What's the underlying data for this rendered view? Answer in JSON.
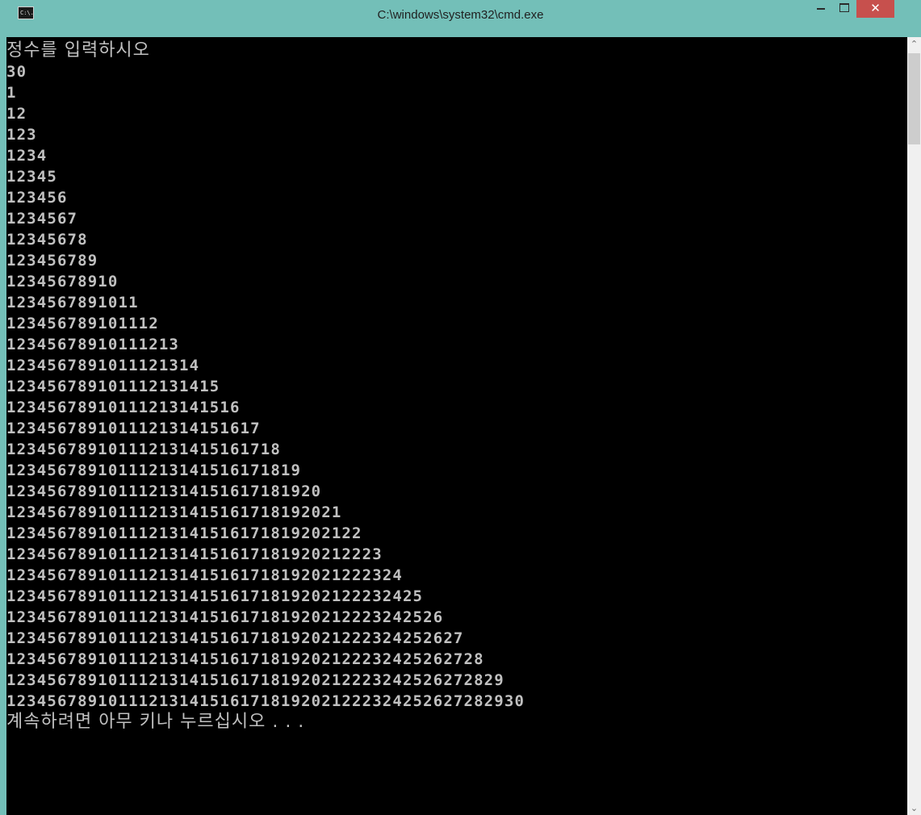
{
  "window": {
    "title": "C:\\windows\\system32\\cmd.exe",
    "icon_label": "C:\\.",
    "close_glyph": "✕"
  },
  "console": {
    "lines": [
      "정수를 입력하시오",
      "30",
      "1",
      "12",
      "123",
      "1234",
      "12345",
      "123456",
      "1234567",
      "12345678",
      "123456789",
      "12345678910",
      "1234567891011",
      "123456789101112",
      "12345678910111213",
      "1234567891011121314",
      "123456789101112131415",
      "12345678910111213141516",
      "1234567891011121314151617",
      "123456789101112131415161718",
      "12345678910111213141516171819",
      "1234567891011121314151617181920",
      "123456789101112131415161718192021",
      "12345678910111213141516171819202122",
      "1234567891011121314151617181920212223",
      "123456789101112131415161718192021222324",
      "12345678910111213141516171819202122232425",
      "1234567891011121314151617181920212223242526",
      "123456789101112131415161718192021222324252627",
      "12345678910111213141516171819202122232425262728",
      "1234567891011121314151617181920212223242526272829",
      "123456789101112131415161718192021222324252627282930",
      "계속하려면 아무 키나 누르십시오 . . ."
    ]
  },
  "colors": {
    "titlebar": "#73bfb8",
    "console_bg": "#000000",
    "console_text": "#c0c0c0",
    "close_button": "#c7504d"
  },
  "icons": {
    "scroll_up": "scroll-up-arrow-icon",
    "scroll_down": "scroll-down-arrow-icon",
    "minimize": "minimize-icon",
    "maximize": "maximize-icon",
    "close": "close-icon"
  },
  "scrollbar": {
    "up_glyph": "⌃",
    "down_glyph": "⌄"
  }
}
